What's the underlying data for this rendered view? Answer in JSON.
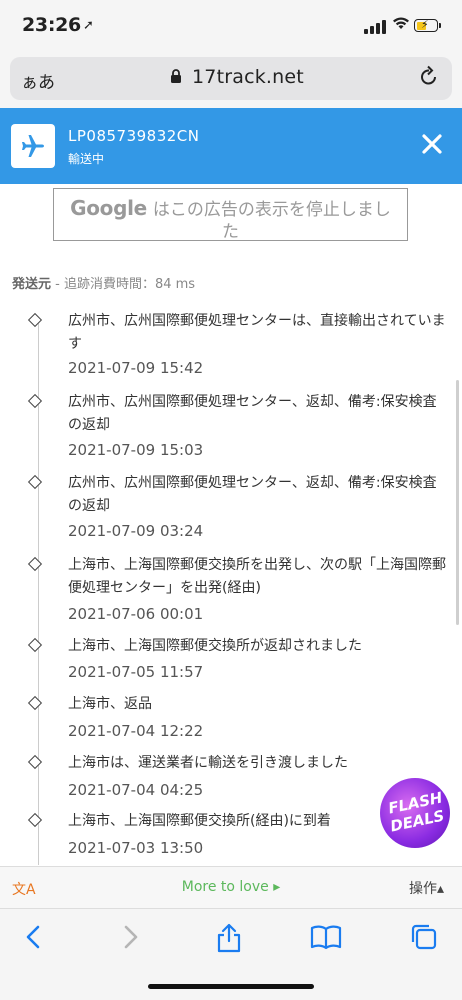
{
  "status_bar": {
    "time": "23:26"
  },
  "browser": {
    "text_size_label": "ぁあ",
    "domain": "17track.net"
  },
  "header": {
    "tracking_number": "LP085739832CN",
    "status": "輸送中"
  },
  "ad": {
    "brand": "Google",
    "message_line1": "はこの広告の表示を停止しまし",
    "message_line2": "た"
  },
  "origin": {
    "label": "発送元",
    "timing": " - 追跡消費時間：84 ms"
  },
  "events": [
    {
      "text": "広州市、広州国際郵便処理センターは、直接輸出されています",
      "date": "2021-07-09 15:42"
    },
    {
      "text": "広州市、広州国際郵便処理センター、返却、備考:保安検査の返却",
      "date": "2021-07-09 15:03"
    },
    {
      "text": "広州市、広州国際郵便処理センター、返却、備考:保安検査の返却",
      "date": "2021-07-09 03:24"
    },
    {
      "text": "上海市、上海国際郵便交換所を出発し、次の駅「上海国際郵便処理センター」を出発(経由)",
      "date": "2021-07-06 00:01"
    },
    {
      "text": "上海市、上海国際郵便交換所が返却されました",
      "date": "2021-07-05 11:57"
    },
    {
      "text": "上海市、返品",
      "date": "2021-07-04 12:22"
    },
    {
      "text": "上海市は、運送業者に輸送を引き渡しました",
      "date": "2021-07-04 04:25"
    },
    {
      "text": "上海市、上海国際郵便交換所(経由)に到着",
      "date": "2021-07-03 13:50"
    }
  ],
  "promo": {
    "line1": "FLASH",
    "line2": "DEALS"
  },
  "bottom_bar": {
    "translate_icon": "文A",
    "more_label": "More to love ▸",
    "actions_label": "操作▴"
  }
}
